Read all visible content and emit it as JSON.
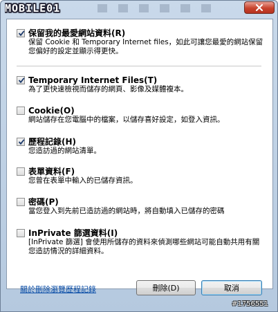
{
  "window": {
    "logo_text": "MOBILE01",
    "close_label": "✕"
  },
  "options": [
    {
      "label": "保留我的最愛網站資料(R)",
      "checked": true,
      "description": "保留 Cookie 和 Temporary Internet files，如此可讓您最愛的網站保留您偏好的設定並顯示得更快。"
    },
    {
      "label": "Temporary Internet Files(T)",
      "checked": true,
      "description": "為了更快速檢視而儲存的網頁、影像及媒體複本。"
    },
    {
      "label": "Cookie(O)",
      "checked": false,
      "description": "網站儲存在您電腦中的檔案，以儲存喜好設定，如登入資訊。"
    },
    {
      "label": "歷程記錄(H)",
      "checked": true,
      "description": "您造訪過的網站清單。"
    },
    {
      "label": "表單資料(F)",
      "checked": false,
      "description": "您曾在表單中輸入的已儲存資訊。"
    },
    {
      "label": "密碼(P)",
      "checked": false,
      "description": "當您登入到先前已造訪過的網站時，將自動填入已儲存的密碼"
    },
    {
      "label": "InPrivate 篩選資料(I)",
      "checked": false,
      "description": "[InPrivate 篩選] 會使用所儲存的資料來偵測哪些網站可能自動共用有關您造訪情況的詳細資料。"
    }
  ],
  "footer": {
    "about_link": "關於刪除瀏覽歷程記錄",
    "delete_button": "刪除(D)",
    "cancel_button": "取消"
  },
  "watermark": "#1756551"
}
